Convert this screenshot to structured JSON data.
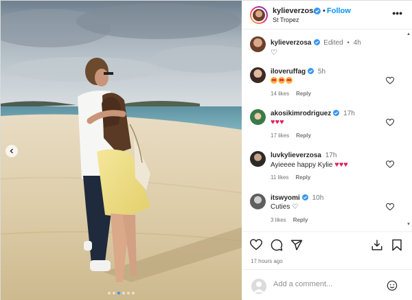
{
  "post": {
    "dots": 6,
    "active_dot": 2
  },
  "header": {
    "username": "kylieverzosa",
    "separator": "•",
    "follow_label": "Follow",
    "location": "St Tropez",
    "more_icon": "more-horizontal-icon"
  },
  "caption": {
    "username": "kylieverzosa",
    "edited": "Edited",
    "sep": "•",
    "time": "4h",
    "text": "♡"
  },
  "comments": [
    {
      "username": "iloveruffag",
      "time": "5h",
      "text_emoji": "heart-eyes x3",
      "likes": "14 likes",
      "reply": "Reply",
      "avatar_color": "#6d5a52"
    },
    {
      "username": "akosikimrodriguez",
      "time": "17h",
      "text": "♥♥♥",
      "likes": "17 likes",
      "reply": "Reply",
      "avatar_color": "#3a7a4a"
    },
    {
      "username": "luvkylieverzosa",
      "time": "17h",
      "text": "Ayieeee happy Kylie",
      "text_hearts": "♥♥♥",
      "likes": "11 likes",
      "reply": "Reply",
      "avatar_color": "#2d2a26"
    },
    {
      "username": "itswyomi",
      "time": "10h",
      "text": "Cuties ♡",
      "likes": "3 likes",
      "reply": "Reply",
      "avatar_color": "#8a8a8a"
    }
  ],
  "actions": {
    "posted": "17 hours ago",
    "icons": [
      "heart-icon",
      "comment-icon",
      "share-icon",
      "add-to-story-icon",
      "bookmark-icon"
    ]
  },
  "add_comment": {
    "placeholder": "Add a comment..."
  },
  "colors": {
    "link": "#0095f6",
    "verified": "#3897f0",
    "heart_red": "#e0245e"
  }
}
